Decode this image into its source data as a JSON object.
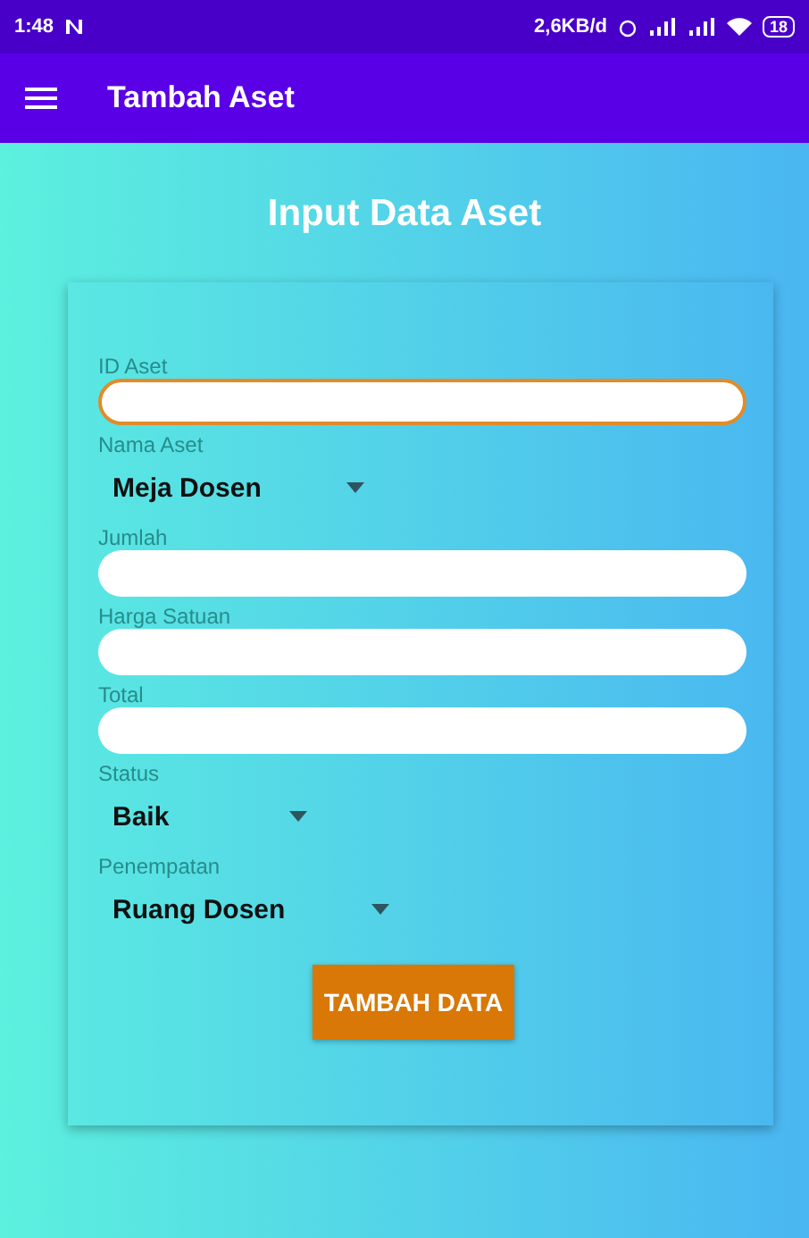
{
  "status_bar": {
    "time": "1:48",
    "network_speed": "2,6KB/d",
    "battery": "18"
  },
  "app_bar": {
    "title": "Tambah Aset"
  },
  "heading": "Input Data Aset",
  "form": {
    "fields": [
      {
        "kind": "text",
        "label": "ID Aset",
        "focused": true
      },
      {
        "kind": "dropdown",
        "label": "Nama Aset",
        "value": "Meja Dosen"
      },
      {
        "kind": "text",
        "label": "Jumlah",
        "focused": false
      },
      {
        "kind": "text",
        "label": "Harga Satuan",
        "focused": false
      },
      {
        "kind": "text",
        "label": "Total",
        "focused": false
      },
      {
        "kind": "dropdown",
        "label": "Status",
        "value": "Baik"
      },
      {
        "kind": "dropdown",
        "label": "Penempatan",
        "value": "Ruang Dosen"
      }
    ],
    "submit": "TAMBAH DATA"
  }
}
